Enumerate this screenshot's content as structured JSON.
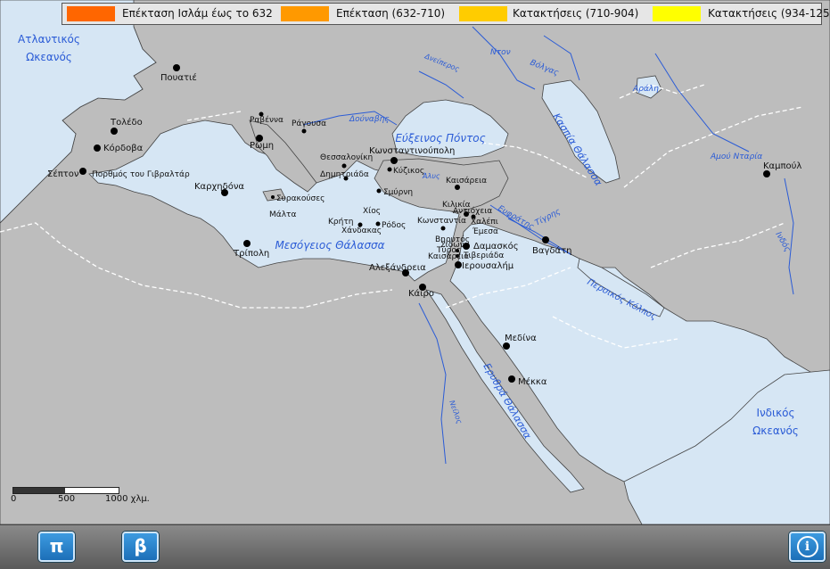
{
  "legend": [
    {
      "label": "Επέκταση Ισλάμ έως το 632",
      "color": "#ff6600"
    },
    {
      "label": "Επέκταση (632-710)",
      "color": "#ff9900"
    },
    {
      "label": "Κατακτήσεις  (710-904)",
      "color": "#ffcc00"
    },
    {
      "label": "Κατακτήσεις (934-1258)",
      "color": "#ffff00"
    }
  ],
  "oceans": {
    "atlantic_1": "Ατλαντικός",
    "atlantic_2": "Ωκεανός",
    "indian_1": "Ινδικός",
    "indian_2": "Ωκεανός"
  },
  "seas": {
    "mediterranean": "Μεσόγειος Θάλασσα",
    "black": "Εύξεινος Πόντος",
    "caspian": "Κασπία Θάλασσα",
    "red": "Ερυθρά Θάλασσα",
    "gulf": "Περσικός Κόλπος",
    "aral": "Αράλη"
  },
  "rivers": {
    "danube": "Δούναβης",
    "dnieper": "Δνείπερος",
    "don": "Ντον",
    "volga": "Βόλγας",
    "amu": "Αμού Νταρία",
    "indus": "Ινδός",
    "euphrates": "Ευφράτης",
    "tigris": "Τίγρης",
    "nile": "Νείλος",
    "halys": "Άλυς"
  },
  "cities": {
    "poitiers": "Πουατιέ",
    "toledo": "Τολέδο",
    "cordoba": "Κόρδοβα",
    "ceuta": "Σέπτον",
    "gibraltar": "Πορθμός του Γιβραλτάρ",
    "carthage": "Καρχηδόνα",
    "tripoli": "Τρίπολη",
    "ravenna": "Ραβέννα",
    "rome": "Ρώμη",
    "ragusa": "Ράγουσα",
    "syracuse": "Συρακούσες",
    "malta": "Μάλτα",
    "thessaloniki": "Θεσσαλονίκη",
    "demetrias": "Δημητριάδα",
    "constantinople": "Κωνσταντινούπολη",
    "cyzicus": "Κύζικος",
    "smyrna": "Σμύρνη",
    "chios": "Χίος",
    "crete": "Κρήτη",
    "chandax": "Χάνδακας",
    "rhodes": "Ρόδος",
    "kaisareia": "Καισάρεια",
    "constantia": "Κωνσταντία",
    "cilicia": "Κιλικία",
    "antioch": "Αντιόχεια",
    "aleppo": "Χαλέπι",
    "emesa": "Έμεσα",
    "beirut": "Βηρυτός",
    "sidon": "Σιδών",
    "tyre": "Τύρος",
    "caesarea": "Καισάρεια",
    "damascus": "Δαμασκός",
    "tiberias": "Τιβεριάδα",
    "jerusalem": "Ιερουσαλήμ",
    "alexandria": "Αλεξάνδρεια",
    "cairo": "Κάιρο",
    "baghdad": "Βαγδάτη",
    "medina": "Μεδίνα",
    "mecca": "Μέκκα",
    "kabul": "Καμπούλ"
  },
  "scale": {
    "zero": "0",
    "mid": "500",
    "end": "1000 χλμ."
  },
  "buttons": {
    "pi": "π",
    "beta": "β",
    "info": "i"
  }
}
